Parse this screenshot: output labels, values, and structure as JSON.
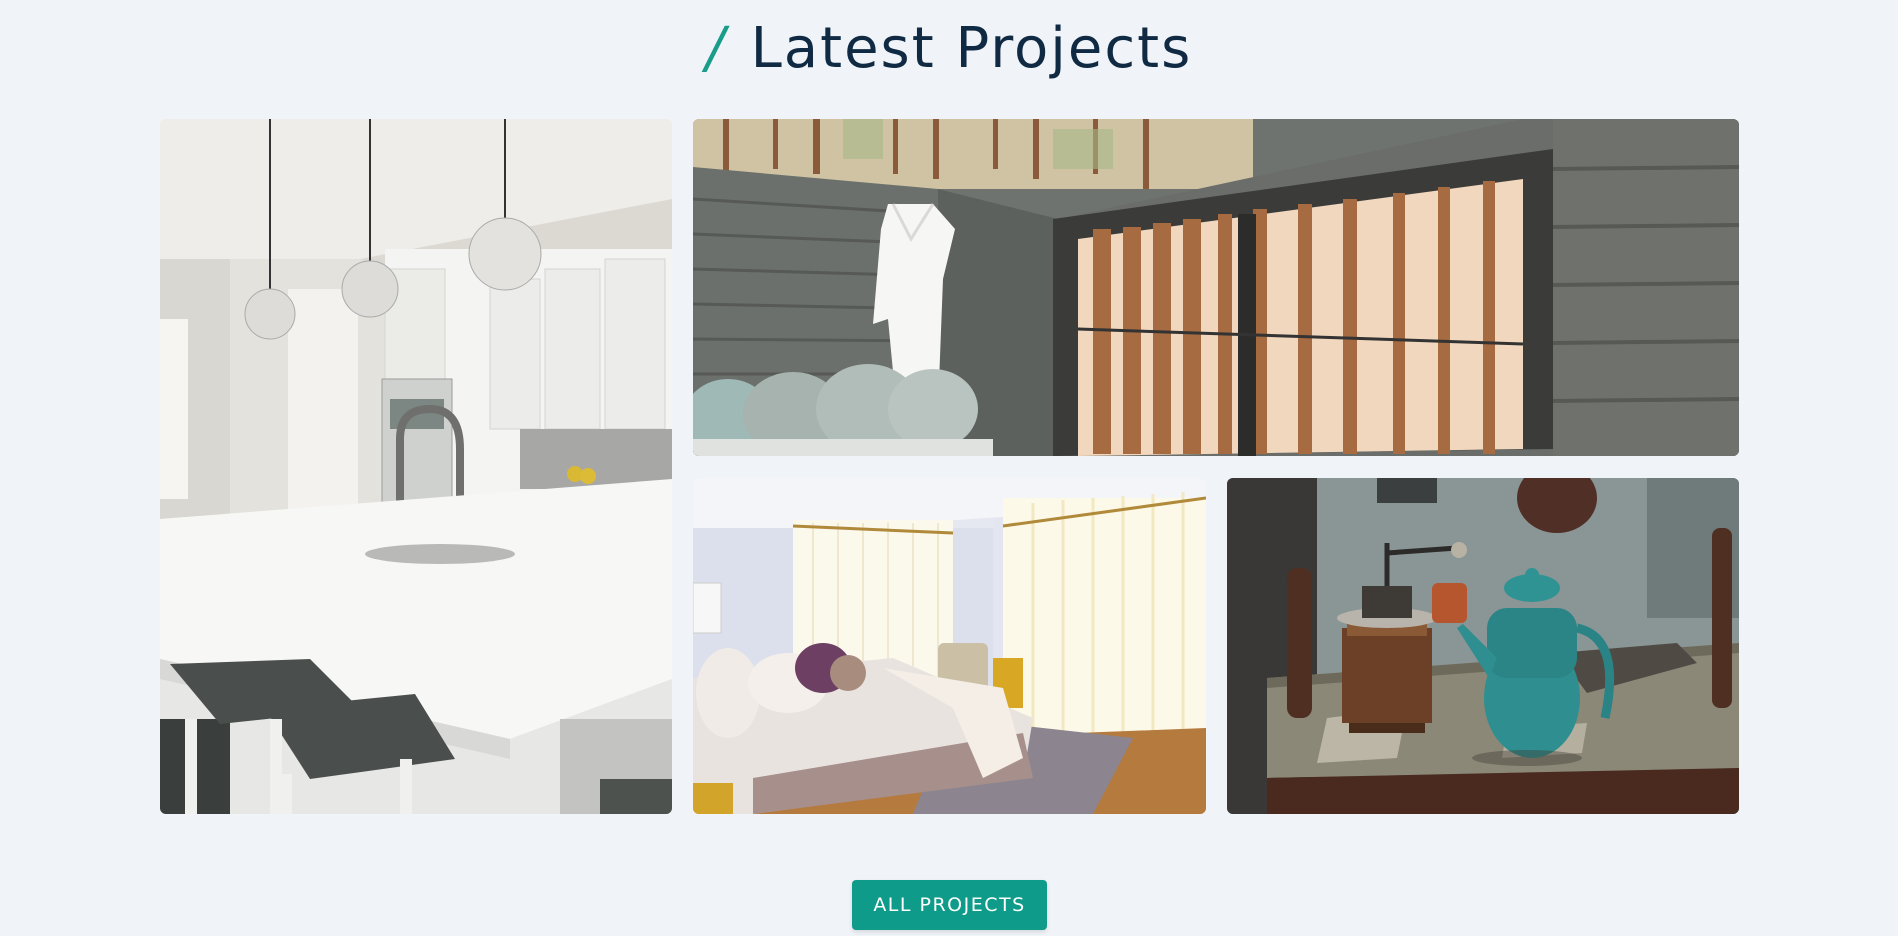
{
  "section": {
    "slash": "/",
    "title": "Latest Projects"
  },
  "projects": [
    {
      "image": "kitchen-island-photo"
    },
    {
      "image": "outdoor-bath-deck-photo"
    },
    {
      "image": "bright-bedroom-photo"
    },
    {
      "image": "teapot-coffee-grinder-photo"
    }
  ],
  "cta": {
    "label": "ALL PROJECTS"
  },
  "colors": {
    "background": "#f0f4f8",
    "heading": "#102a43",
    "accent": "#199c8a",
    "button": "#0f9b8a",
    "button_text": "#ffffff"
  }
}
